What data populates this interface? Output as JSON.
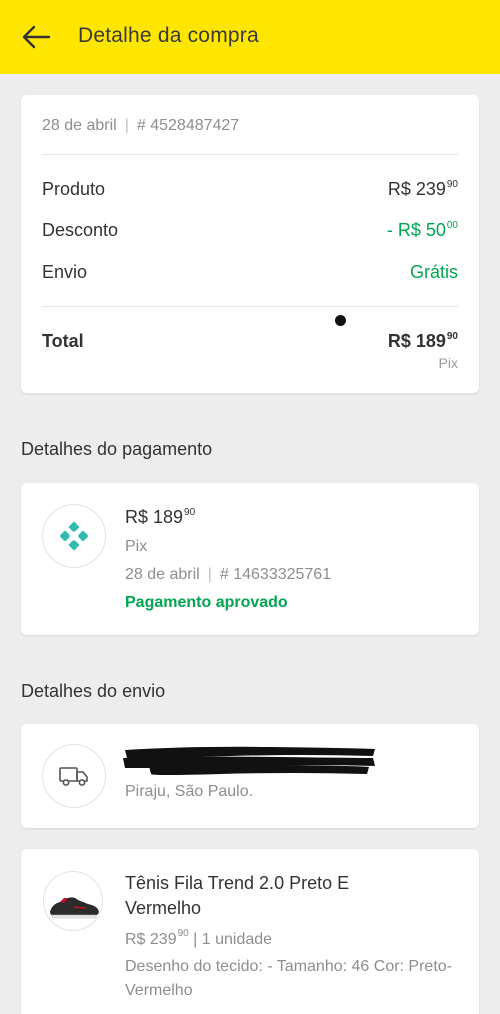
{
  "header": {
    "title": "Detalhe da compra",
    "back_icon": "arrow-left-icon",
    "color": "#ffe600"
  },
  "summary": {
    "date": "28 de abril",
    "separator": "|",
    "order_number": "# 4528487427",
    "rows": [
      {
        "label": "Produto",
        "value": "R$ 239",
        "cents": "90"
      },
      {
        "label": "Desconto",
        "value": "- R$ 50",
        "cents": "00"
      },
      {
        "label": "Envio",
        "value": "Grátis"
      }
    ],
    "total": {
      "label": "Total",
      "value": "R$ 189",
      "cents": "90",
      "method": "Pix"
    }
  },
  "payment": {
    "section_title": "Detalhes do pagamento",
    "amount": "R$ 189",
    "cents": "90",
    "method": "Pix",
    "date": "28 de abril",
    "separator": "|",
    "transaction": "# 14633325761",
    "status": "Pagamento aprovado",
    "icon": "pix-icon",
    "icon_color": "#32bcad"
  },
  "shipping": {
    "section_title": "Detalhes do envio",
    "city": "Piraju, São Paulo.",
    "icon": "truck-icon"
  },
  "product": {
    "title": "Tênis Fila Trend 2.0 Preto E Vermelho",
    "price": "R$ 239",
    "cents": "90",
    "quantity": "| 1 unidade",
    "description": "Desenho do tecido: - Tamanho: 46 Cor: Preto-Vermelho"
  },
  "colors": {
    "green": "#00a650",
    "header_yellow": "#ffe600"
  }
}
